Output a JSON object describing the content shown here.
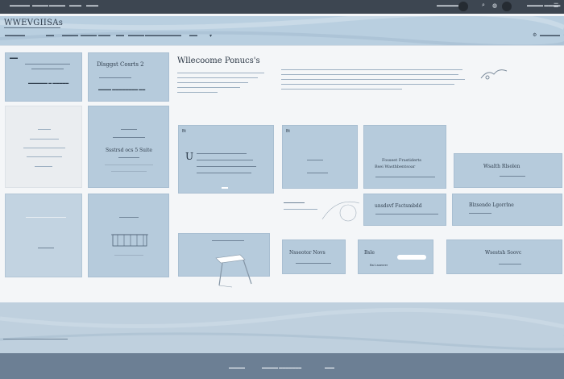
{
  "top_nav": {
    "links": [
      "▬▬▬▬▬",
      "▬▬▬▬",
      "▬▬▬▬",
      "▬▬▬",
      "▬▬▬"
    ],
    "right_label": "▬▬▬▬▬▬",
    "account_label": "▬▬▬▬ ▬▬▬▬"
  },
  "site": {
    "logo": "WWEVGIISAs"
  },
  "main_nav": [
    "▬▬▬▬▬",
    "▬▬",
    "▬▬▬▬",
    "▬▬▬▬",
    "▬▬▬",
    "▬▬",
    "▬▬▬▬",
    "▬▬▬▬▬▬▬",
    "▬▬▬▬",
    "▬▬"
  ],
  "cards": {
    "c1": {
      "label": "▬▬",
      "caption": "▬▬▬▬▬▬ ▬ ▬▬▬▬▬"
    },
    "c2": {
      "title": "Dlsggst Cosrts 2",
      "caption": "▬▬▬▬ ▬▬▬▬▬▬▬▬ ▬▬"
    },
    "welcome": {
      "title": "Wllecoome Ponucs's"
    },
    "mid": {
      "title": "Ssstrsd ocs 5 Suite"
    },
    "photo_card": {
      "label": "Bt",
      "logo_letter": "U"
    },
    "card_bt2": {
      "label": "Bt"
    },
    "card_prod": {
      "title": "Fosseet Frastiderts",
      "subtitle": "Bsei Wasthbentsoar"
    },
    "card_wealth": {
      "title": "Wsalth Rlsolen"
    },
    "card_dub": {
      "title": "unsdsvf Fsctsmbdd"
    },
    "card_brand": {
      "title": "Blzsende Lgorrlne"
    },
    "card_nova": {
      "title": "Nsseotor Novs"
    },
    "card_bl": {
      "title": "Bsle",
      "caption": "Bsl Lssenrer"
    },
    "card_srv": {
      "title": "Wsestsh Soovc"
    }
  },
  "footer": {
    "links": [
      "▬▬▬▬▬",
      "▬▬▬▬▬ ▬▬▬▬▬▬▬",
      "▬▬▬"
    ]
  }
}
